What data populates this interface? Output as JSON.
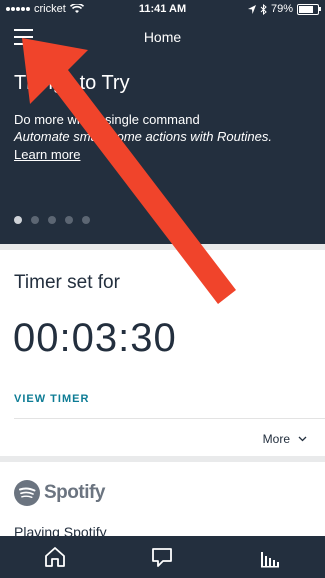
{
  "status_bar": {
    "carrier": "cricket",
    "time": "11:41 AM",
    "battery": "79%",
    "battery_level": 0.79,
    "icons": [
      "wifi-icon",
      "location-icon",
      "bluetooth-icon",
      "battery-icon"
    ]
  },
  "header": {
    "title": "Home",
    "menu_icon": "hamburger-menu-icon"
  },
  "hero": {
    "title": "Things to Try",
    "line1": "Do more with a single command",
    "line2": "Automate smart home actions with Routines.",
    "link": "Learn more",
    "pages": 5,
    "active_page": 1
  },
  "timer_card": {
    "title": "Timer set for",
    "value": "00:03:30",
    "action": "VIEW TIMER",
    "more": "More"
  },
  "spotify_card": {
    "brand": "Spotify",
    "status": "Playing Spotify"
  },
  "tabs": [
    {
      "name": "home",
      "icon": "home-icon"
    },
    {
      "name": "communicate",
      "icon": "chat-bubble-icon"
    },
    {
      "name": "play",
      "icon": "equalizer-icon"
    }
  ],
  "colors": {
    "header_bg": "#232f3e",
    "accent_link": "#0e7c95",
    "annotation_arrow": "#f0442b",
    "page_bg": "#e9eaeb"
  }
}
